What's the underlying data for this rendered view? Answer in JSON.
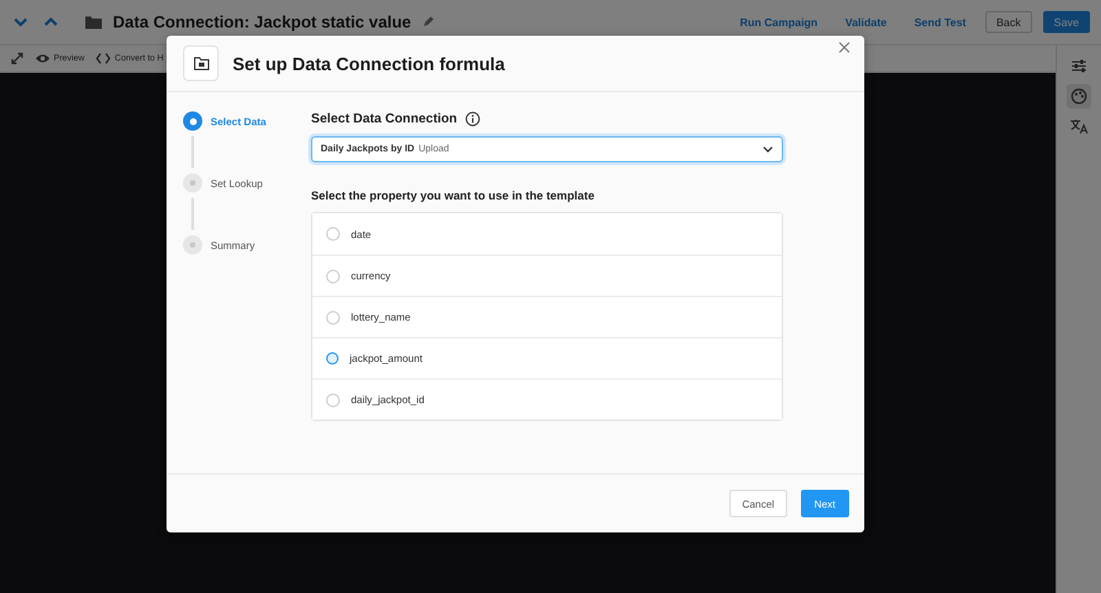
{
  "app": {
    "header": {
      "title": "Data Connection: Jackpot static value",
      "actions": [
        "Run Campaign",
        "Validate",
        "Send Test"
      ],
      "buttons": [
        {
          "label": "Back",
          "kind": "secondary"
        },
        {
          "label": "Save",
          "kind": "primary"
        }
      ]
    },
    "toolbar": [
      {
        "label": "Preview",
        "kind": "eye"
      },
      {
        "label": "Convert to H",
        "kind": "code"
      }
    ],
    "side_tools": [
      {
        "kind": "sliders",
        "selected": false
      },
      {
        "kind": "palette",
        "selected": true
      },
      {
        "kind": "translate",
        "selected": false
      }
    ]
  },
  "dialog": {
    "title": "Set up Data Connection formula",
    "steps": [
      {
        "label": "Select Data",
        "selected": true
      },
      {
        "label": "Set Lookup",
        "selected": false
      },
      {
        "label": "Summary",
        "selected": false
      }
    ],
    "connection_label": "Select Data Connection",
    "connection": {
      "name": "Daily Jackpots by ID",
      "type": "Upload"
    },
    "property_prompt": "Select the property you want to use in the template",
    "properties": [
      {
        "label": "date",
        "selected": false,
        "hovered": false
      },
      {
        "label": "currency",
        "selected": false,
        "hovered": false
      },
      {
        "label": "lottery_name",
        "selected": false,
        "hovered": false
      },
      {
        "label": "jackpot_amount",
        "selected": false,
        "hovered": true
      },
      {
        "label": "daily_jackpot_id",
        "selected": false,
        "hovered": false
      }
    ],
    "buttons": [
      {
        "label": "Cancel",
        "kind": "secondary"
      },
      {
        "label": "Next",
        "kind": "primary"
      }
    ]
  }
}
